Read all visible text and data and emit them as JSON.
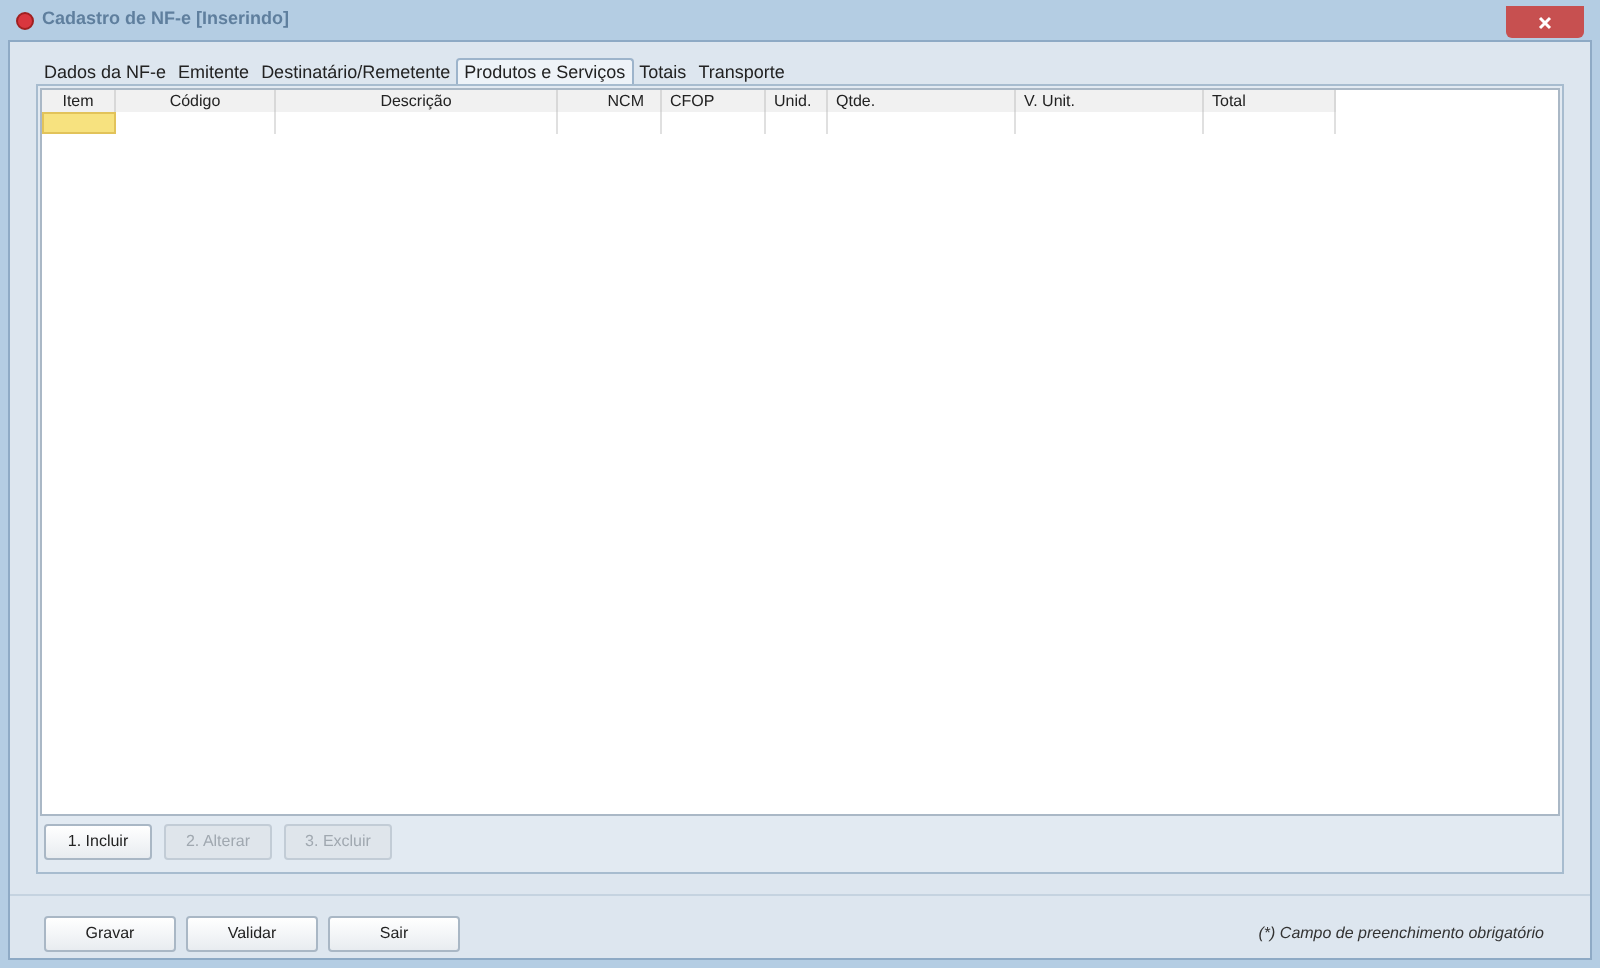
{
  "window": {
    "title": "Cadastro de NF-e [Inserindo]"
  },
  "tabs": [
    {
      "label": "Dados da NF-e",
      "selected": false
    },
    {
      "label": "Emitente",
      "selected": false
    },
    {
      "label": "Destinatário/Remetente",
      "selected": false
    },
    {
      "label": "Produtos e Serviços",
      "selected": true
    },
    {
      "label": "Totais",
      "selected": false
    },
    {
      "label": "Transporte",
      "selected": false
    }
  ],
  "table": {
    "columns": [
      {
        "label": "Item"
      },
      {
        "label": "Código"
      },
      {
        "label": "Descrição"
      },
      {
        "label": "NCM"
      },
      {
        "label": "CFOP"
      },
      {
        "label": "Unid."
      },
      {
        "label": "Qtde."
      },
      {
        "label": "V. Unit."
      },
      {
        "label": "Total"
      }
    ]
  },
  "item_buttons": [
    {
      "label": "1. Incluir",
      "disabled": false
    },
    {
      "label": "2. Alterar",
      "disabled": true
    },
    {
      "label": "3. Excluir",
      "disabled": true
    }
  ],
  "footer_buttons": [
    {
      "label": "Gravar"
    },
    {
      "label": "Validar"
    },
    {
      "label": "Sair"
    }
  ],
  "note": "(*) Campo de preenchimento obrigatório"
}
